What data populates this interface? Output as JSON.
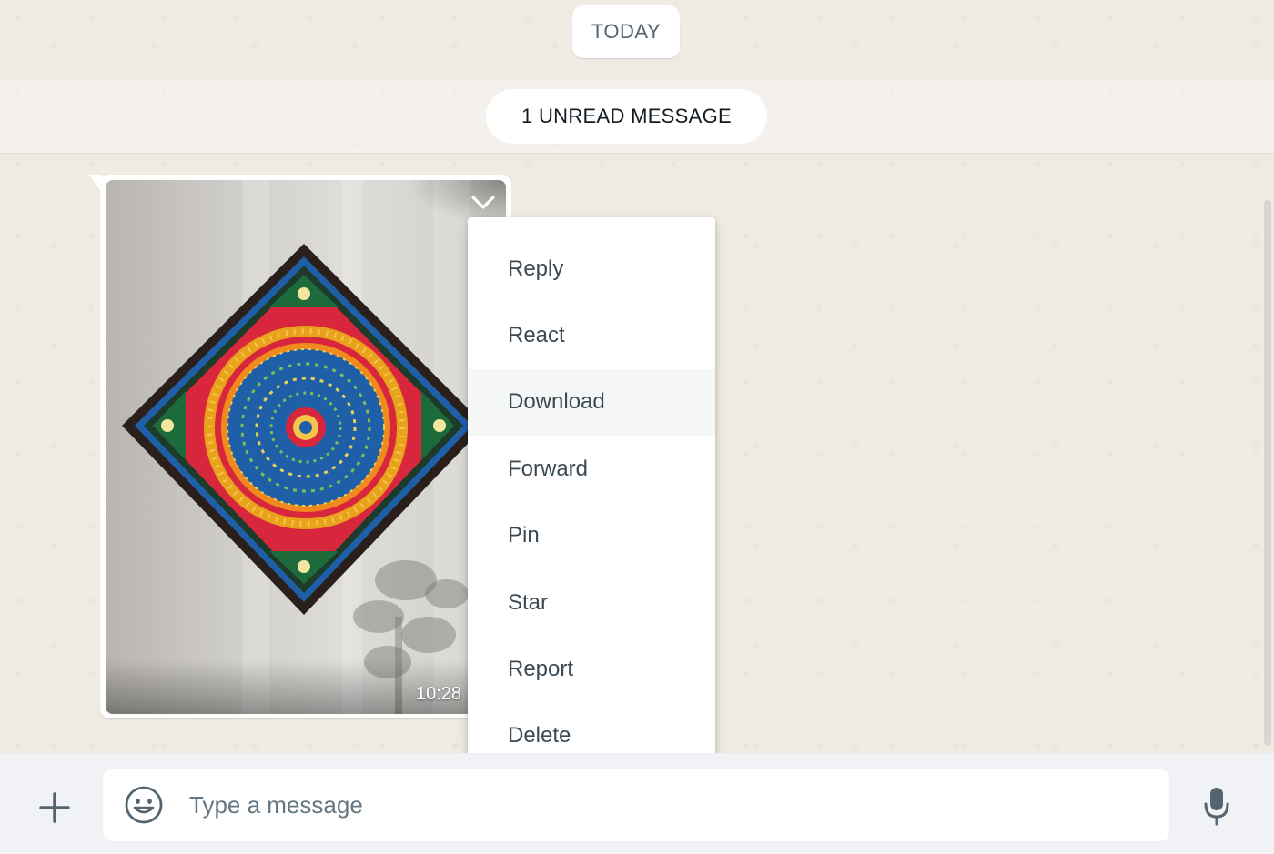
{
  "chat": {
    "date_label": "TODAY",
    "unread_label": "1 UNREAD MESSAGE"
  },
  "message": {
    "time": "10:28",
    "type": "image"
  },
  "context_menu": {
    "items": [
      {
        "label": "Reply"
      },
      {
        "label": "React"
      },
      {
        "label": "Download"
      },
      {
        "label": "Forward"
      },
      {
        "label": "Pin"
      },
      {
        "label": "Star"
      },
      {
        "label": "Report"
      },
      {
        "label": "Delete"
      }
    ],
    "highlighted": "Download"
  },
  "composer": {
    "placeholder": "Type a message",
    "value": "",
    "icons": [
      "plus-icon",
      "emoji-icon",
      "microphone-icon"
    ]
  },
  "colors": {
    "background": "#efeae2",
    "bubble": "#ffffff",
    "menu_text": "#3b4a54",
    "icon": "#54656f"
  }
}
